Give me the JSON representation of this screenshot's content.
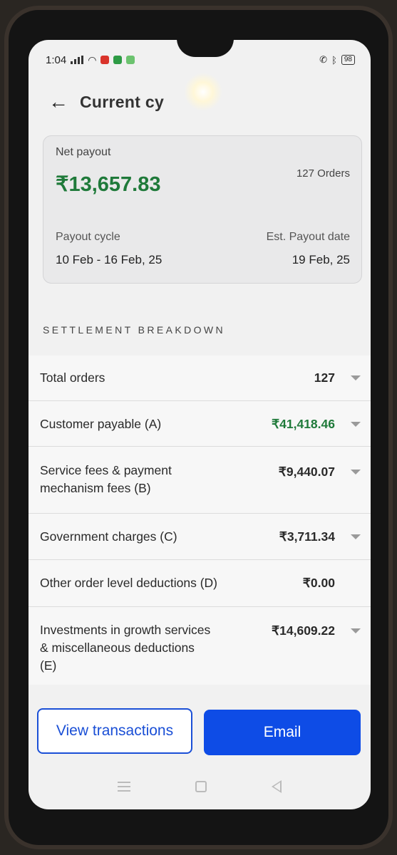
{
  "status_bar": {
    "time": "1:04",
    "battery": "98"
  },
  "header": {
    "title": "Current cy"
  },
  "summary": {
    "net_payout_label": "Net payout",
    "net_payout_amount": "₹13,657.83",
    "orders_count": "127 Orders",
    "payout_cycle_label": "Payout cycle",
    "payout_cycle_value": "10 Feb - 16 Feb, 25",
    "est_date_label": "Est. Payout date",
    "est_date_value": "19 Feb, 25"
  },
  "breakdown": {
    "heading": "SETTLEMENT BREAKDOWN",
    "rows": [
      {
        "label": "Total orders",
        "value": "127"
      },
      {
        "label": "Customer payable (A)",
        "value": "₹41,418.46"
      },
      {
        "label": "Service fees & payment mechanism fees (B)",
        "value": "₹9,440.07"
      },
      {
        "label": "Government charges (C)",
        "value": "₹3,711.34"
      },
      {
        "label": "Other order level deductions (D)",
        "value": "₹0.00"
      },
      {
        "label": "Investments in growth services & miscellaneous deductions (E)",
        "value": "₹14,609.22"
      }
    ]
  },
  "footer": {
    "view_transactions_label": "View transactions",
    "email_label": "Email"
  },
  "colors": {
    "accent_green": "#1f7a3a",
    "primary_blue": "#0e4ce6"
  },
  "icons": {
    "back": "arrow-left-icon",
    "expand": "chevron-down-icon"
  }
}
